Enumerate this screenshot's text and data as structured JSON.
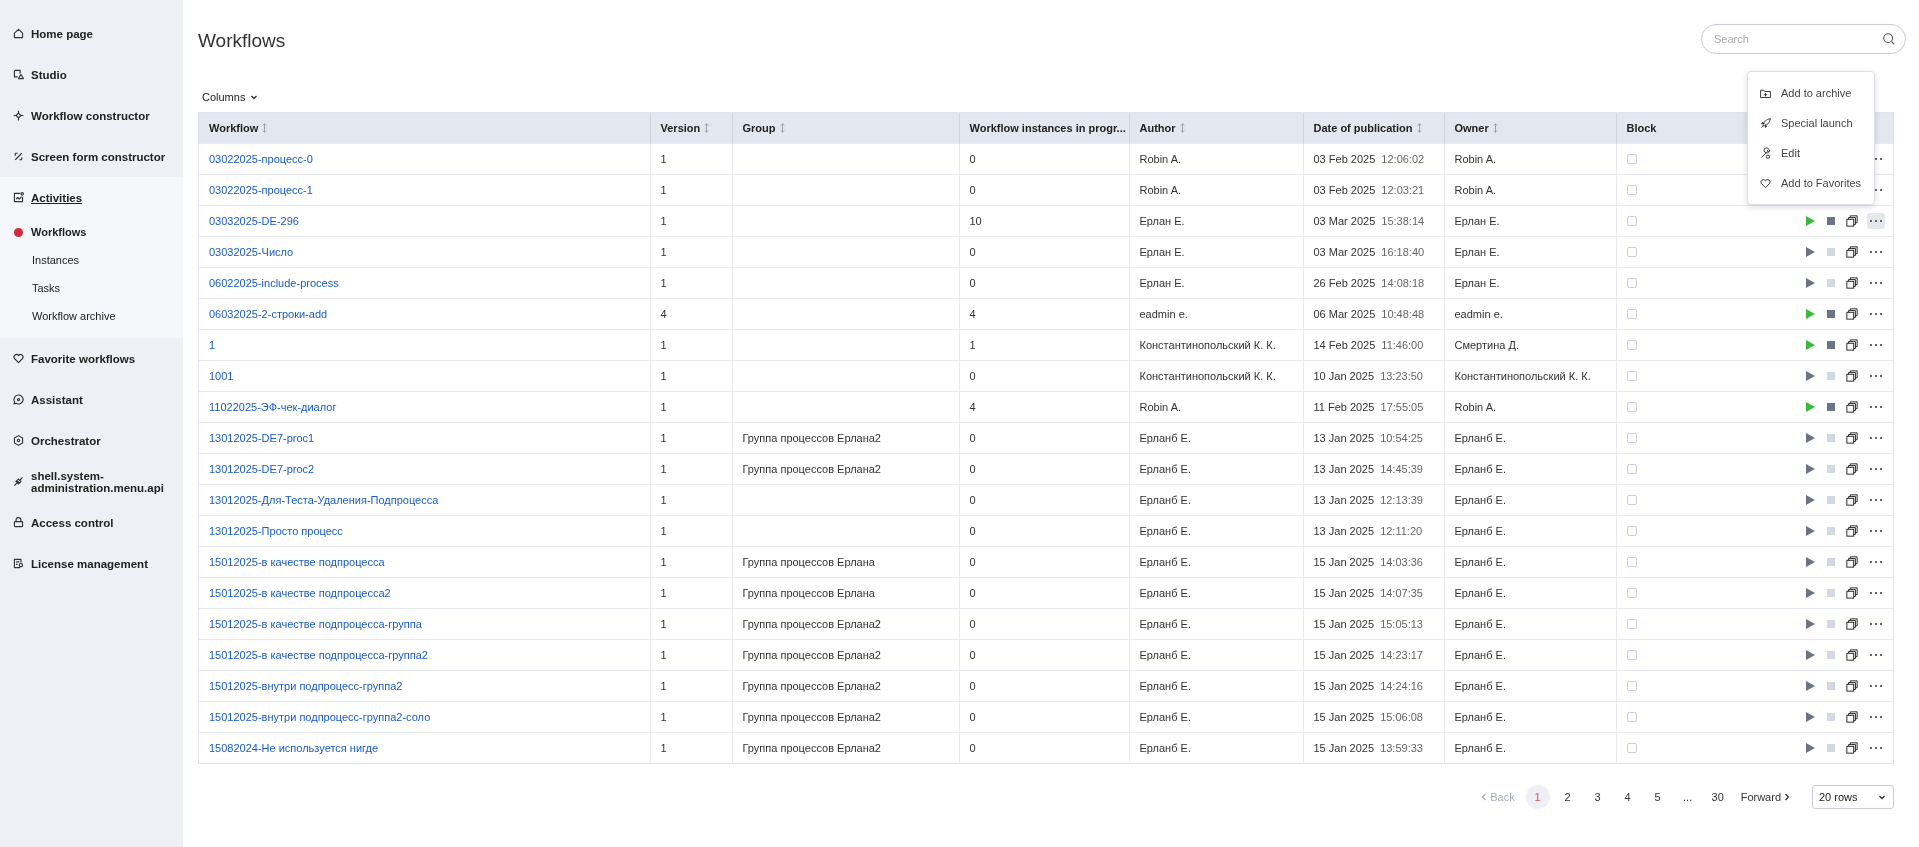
{
  "sidebar": {
    "items": [
      {
        "label": "Home page",
        "expanded": false
      },
      {
        "label": "Studio",
        "expanded": false
      },
      {
        "label": "Workflow constructor",
        "expanded": false
      },
      {
        "label": "Screen form constructor",
        "expanded": false
      },
      {
        "label": "Activities",
        "expanded": true,
        "children": [
          {
            "label": "Workflows",
            "selected": true
          },
          {
            "label": "Instances",
            "selected": false
          },
          {
            "label": "Tasks",
            "selected": false
          },
          {
            "label": "Workflow archive",
            "selected": false
          }
        ]
      },
      {
        "label": "Favorite workflows",
        "expanded": false
      },
      {
        "label": "Assistant",
        "expanded": false
      },
      {
        "label": "Orchestrator",
        "expanded": false
      },
      {
        "label": "shell.system-administration.menu.api",
        "expanded": false
      },
      {
        "label": "Access control",
        "expanded": false
      },
      {
        "label": "License management",
        "expanded": false
      }
    ]
  },
  "page": {
    "title": "Workflows",
    "search": {
      "placeholder": "Search"
    },
    "columns_button": "Columns"
  },
  "table": {
    "columns": [
      {
        "label": "Workflow",
        "sortable": true
      },
      {
        "label": "Version",
        "sortable": true
      },
      {
        "label": "Group",
        "sortable": true
      },
      {
        "label": "Workflow instances in progr...",
        "sortable": false
      },
      {
        "label": "Author",
        "sortable": true
      },
      {
        "label": "Date of publication",
        "sortable": true
      },
      {
        "label": "Owner",
        "sortable": true
      },
      {
        "label": "Block",
        "sortable": false
      }
    ],
    "rows": [
      {
        "workflow": "03022025-процесс-0",
        "version": "1",
        "group": "",
        "instances": "0",
        "author": "Robin A.",
        "date": "03 Feb 2025",
        "time": "12:06:02",
        "owner": "Robin A.",
        "blocked": false,
        "menu_open": false
      },
      {
        "workflow": "03022025-процесс-1",
        "version": "1",
        "group": "",
        "instances": "0",
        "author": "Robin A.",
        "date": "03 Feb 2025",
        "time": "12:03:21",
        "owner": "Robin A.",
        "blocked": false,
        "menu_open": false
      },
      {
        "workflow": "03032025-DE-296",
        "version": "1",
        "group": "",
        "instances": "10",
        "author": "Ерлан Е.",
        "date": "03 Mar 2025",
        "time": "15:38:14",
        "owner": "Ерлан Е.",
        "blocked": false,
        "running": true,
        "menu_open": true
      },
      {
        "workflow": "03032025-Число",
        "version": "1",
        "group": "",
        "instances": "0",
        "author": "Ерлан Е.",
        "date": "03 Mar 2025",
        "time": "16:18:40",
        "owner": "Ерлан Е.",
        "blocked": false,
        "running": false,
        "menu_open": false
      },
      {
        "workflow": "06022025-include-process",
        "version": "1",
        "group": "",
        "instances": "0",
        "author": "Ерлан Е.",
        "date": "26 Feb 2025",
        "time": "14:08:18",
        "owner": "Ерлан Е.",
        "blocked": false,
        "running": false,
        "menu_open": false
      },
      {
        "workflow": "06032025-2-строки-add",
        "version": "4",
        "group": "",
        "instances": "4",
        "author": "eadmin e.",
        "date": "06 Mar 2025",
        "time": "10:48:48",
        "owner": "eadmin e.",
        "blocked": false,
        "running": true,
        "menu_open": false
      },
      {
        "workflow": "1",
        "version": "1",
        "group": "",
        "instances": "1",
        "author": "Константинопольский К. К.",
        "date": "14 Feb 2025",
        "time": "11:46:00",
        "owner": "Смертина Д.",
        "blocked": false,
        "running": true,
        "menu_open": false
      },
      {
        "workflow": "1001",
        "version": "1",
        "group": "",
        "instances": "0",
        "author": "Константинопольский К. К.",
        "date": "10 Jan 2025",
        "time": "13:23:50",
        "owner": "Константинопольский К. К.",
        "blocked": false,
        "running": false,
        "menu_open": false
      },
      {
        "workflow": "11022025-ЭФ-чек-диалог",
        "version": "1",
        "group": "",
        "instances": "4",
        "author": "Robin A.",
        "date": "11 Feb 2025",
        "time": "17:55:05",
        "owner": "Robin A.",
        "blocked": false,
        "running": true,
        "menu_open": false
      },
      {
        "workflow": "13012025-DE7-proc1",
        "version": "1",
        "group": "Группа процессов Ерлана2",
        "instances": "0",
        "author": "Ерланб Е.",
        "date": "13 Jan 2025",
        "time": "10:54:25",
        "owner": "Ерланб Е.",
        "blocked": false,
        "running": false,
        "menu_open": false
      },
      {
        "workflow": "13012025-DE7-proc2",
        "version": "1",
        "group": "Группа процессов Ерлана2",
        "instances": "0",
        "author": "Ерланб Е.",
        "date": "13 Jan 2025",
        "time": "14:45:39",
        "owner": "Ерланб Е.",
        "blocked": false,
        "running": false,
        "menu_open": false
      },
      {
        "workflow": "13012025-Для-Теста-Удаления-Подпроцесса",
        "version": "1",
        "group": "",
        "instances": "0",
        "author": "Ерланб Е.",
        "date": "13 Jan 2025",
        "time": "12:13:39",
        "owner": "Ерланб Е.",
        "blocked": false,
        "running": false,
        "menu_open": false
      },
      {
        "workflow": "13012025-Просто процесс",
        "version": "1",
        "group": "",
        "instances": "0",
        "author": "Ерланб Е.",
        "date": "13 Jan 2025",
        "time": "12:11:20",
        "owner": "Ерланб Е.",
        "blocked": false,
        "running": false,
        "menu_open": false
      },
      {
        "workflow": "15012025-в качестве подпроцесса",
        "version": "1",
        "group": "Группа процессов Ерлана",
        "instances": "0",
        "author": "Ерланб Е.",
        "date": "15 Jan 2025",
        "time": "14:03:36",
        "owner": "Ерланб Е.",
        "blocked": false,
        "running": false,
        "menu_open": false
      },
      {
        "workflow": "15012025-в качестве подпроцесса2",
        "version": "1",
        "group": "Группа процессов Ерлана",
        "instances": "0",
        "author": "Ерланб Е.",
        "date": "15 Jan 2025",
        "time": "14:07:35",
        "owner": "Ерланб Е.",
        "blocked": false,
        "running": false,
        "menu_open": false
      },
      {
        "workflow": "15012025-в качестве подпроцесса-группа",
        "version": "1",
        "group": "Группа процессов Ерлана2",
        "instances": "0",
        "author": "Ерланб Е.",
        "date": "15 Jan 2025",
        "time": "15:05:13",
        "owner": "Ерланб Е.",
        "blocked": false,
        "running": false,
        "menu_open": false
      },
      {
        "workflow": "15012025-в качестве подпроцесса-группа2",
        "version": "1",
        "group": "Группа процессов Ерлана2",
        "instances": "0",
        "author": "Ерланб Е.",
        "date": "15 Jan 2025",
        "time": "14:23:17",
        "owner": "Ерланб Е.",
        "blocked": false,
        "running": false,
        "menu_open": false
      },
      {
        "workflow": "15012025-внутри подпроцесс-группа2",
        "version": "1",
        "group": "Группа процессов Ерлана2",
        "instances": "0",
        "author": "Ерланб Е.",
        "date": "15 Jan 2025",
        "time": "14:24:16",
        "owner": "Ерланб Е.",
        "blocked": false,
        "running": false,
        "menu_open": false
      },
      {
        "workflow": "15012025-внутри подпроцесс-группа2-соло",
        "version": "1",
        "group": "Группа процессов Ерлана2",
        "instances": "0",
        "author": "Ерланб Е.",
        "date": "15 Jan 2025",
        "time": "15:06:08",
        "owner": "Ерланб Е.",
        "blocked": false,
        "running": false,
        "menu_open": false
      },
      {
        "workflow": "15082024-Не используется нигде",
        "version": "1",
        "group": "Группа процессов Ерлана2",
        "instances": "0",
        "author": "Ерланб Е.",
        "date": "15 Jan 2025",
        "time": "13:59:33",
        "owner": "Ерланб Е.",
        "blocked": false,
        "running": false,
        "menu_open": false
      }
    ]
  },
  "context_menu": {
    "items": [
      {
        "label": "Add to archive"
      },
      {
        "label": "Special launch"
      },
      {
        "label": "Edit"
      },
      {
        "label": "Add to Favorites"
      }
    ]
  },
  "pagination": {
    "back": {
      "label": "Back",
      "disabled": true
    },
    "pages": [
      {
        "label": "1",
        "selected": true
      },
      {
        "label": "2",
        "selected": false
      },
      {
        "label": "3",
        "selected": false
      },
      {
        "label": "4",
        "selected": false
      },
      {
        "label": "5",
        "selected": false
      },
      {
        "label": "...",
        "selected": false
      },
      {
        "label": "30",
        "selected": false
      }
    ],
    "forward": {
      "label": "Forward",
      "disabled": false
    },
    "rows_per_page": "20 rows"
  }
}
